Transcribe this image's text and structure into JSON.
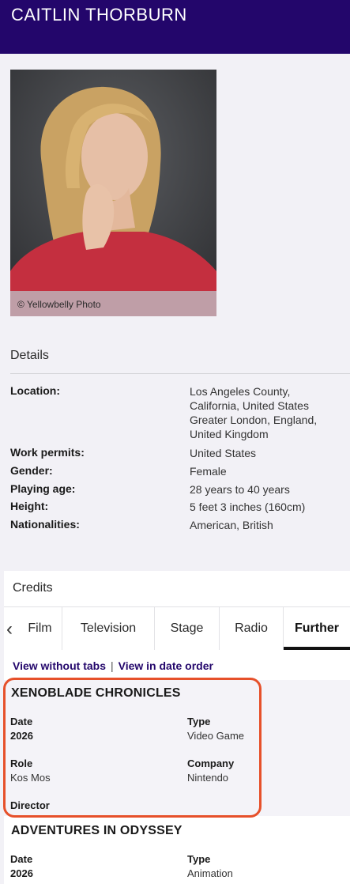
{
  "header": {
    "title": "CAITLIN THORBURN"
  },
  "photo": {
    "caption": "© Yellowbelly Photo"
  },
  "details": {
    "title": "Details",
    "rows": [
      {
        "label": "Location:",
        "value": "Los Angeles County, California, United States Greater London, England, United Kingdom"
      },
      {
        "label": "Work permits:",
        "value": "United States"
      },
      {
        "label": "Gender:",
        "value": "Female"
      },
      {
        "label": "Playing age:",
        "value": "28 years to 40 years"
      },
      {
        "label": "Height:",
        "value": "5 feet 3 inches (160cm)"
      },
      {
        "label": "Nationalities:",
        "value": "American, British"
      }
    ],
    "location_lines": [
      "Los Angeles County,",
      "California, United States",
      "Greater London, England,",
      "United Kingdom"
    ]
  },
  "credits": {
    "title": "Credits",
    "tabs": [
      "Film",
      "Television",
      "Stage",
      "Radio",
      "Further"
    ],
    "active_tab": "Further",
    "links": {
      "without_tabs": "View without tabs",
      "date_order": "View in date order"
    },
    "items": [
      {
        "title": "XENOBLADE CHRONICLES",
        "date_label": "Date",
        "date": "2026",
        "type_label": "Type",
        "type": "Video Game",
        "role_label": "Role",
        "role": "Kos Mos",
        "company_label": "Company",
        "company": "Nintendo",
        "director_label": "Director"
      },
      {
        "title": "ADVENTURES IN ODYSSEY",
        "date_label": "Date",
        "date": "2026",
        "type_label": "Type",
        "type": "Animation"
      }
    ]
  },
  "colors": {
    "header_bg": "#23066b",
    "link": "#23066b",
    "highlight": "#e6502a"
  }
}
